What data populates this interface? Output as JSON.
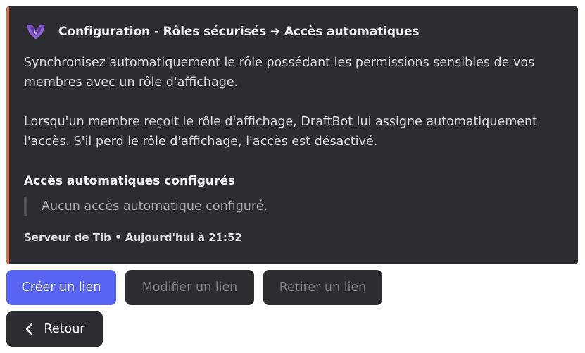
{
  "embed": {
    "accent_color": "#d4704c",
    "author_icon": "draftbot-logo-icon",
    "title": "Configuration - Rôles sécurisés ➔ Accès automatiques",
    "description": {
      "paragraph_1": "Synchronisez automatiquement le rôle possédant les permissions sensibles de vos membres avec un rôle d'affichage.",
      "paragraph_2": "Lorsqu'un membre reçoit le rôle d'affichage, DraftBot lui assigne automatiquement l'accès. S'il perd le rôle d'affichage, l'accès est désactivé."
    },
    "field": {
      "name": "Accès automatiques configurés",
      "value": "Aucun accès automatique configuré."
    },
    "footer": "Serveur de Tib • Aujourd'hui à 21:52"
  },
  "buttons": {
    "create": "Créer un lien",
    "modify": "Modifier un lien",
    "remove": "Retirer un lien",
    "back": "Retour"
  },
  "colors": {
    "primary": "#5865f2",
    "embed_bg": "#2b2d31"
  }
}
